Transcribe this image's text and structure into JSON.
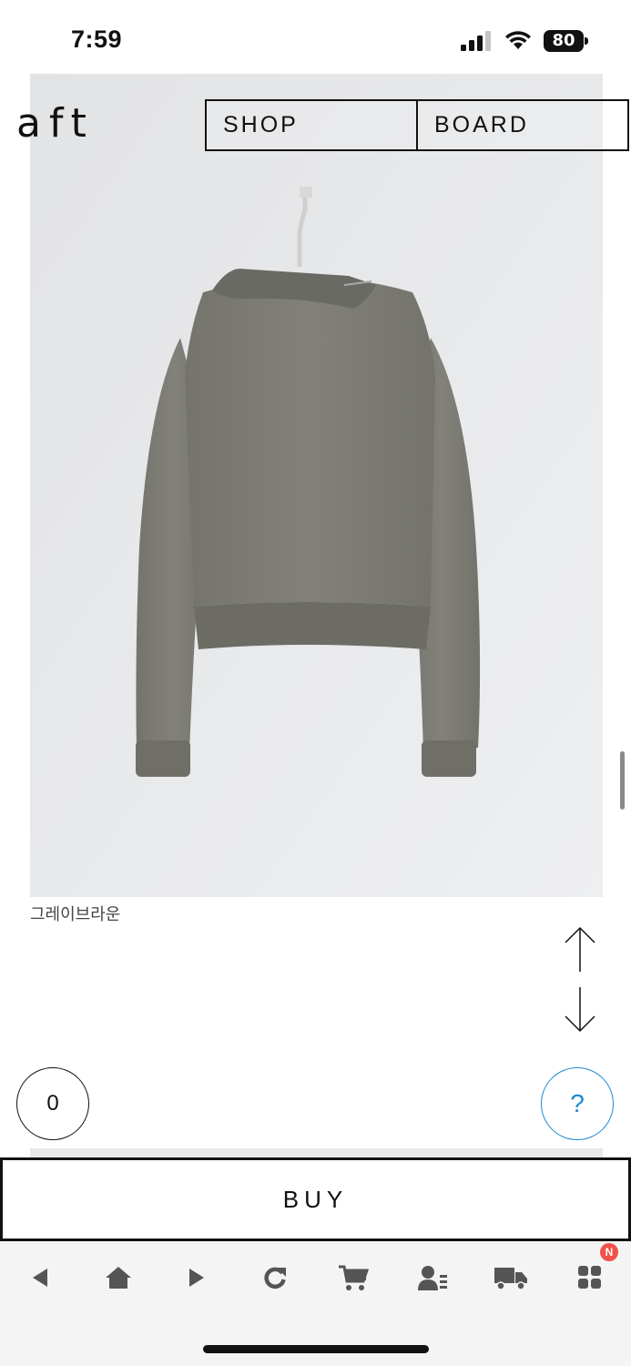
{
  "status_bar": {
    "time": "7:59",
    "battery": "80"
  },
  "header": {
    "logo": "aft",
    "nav": [
      {
        "label": "SHOP"
      },
      {
        "label": "BOARD"
      }
    ]
  },
  "product": {
    "color_caption": "그레이브라운"
  },
  "controls": {
    "scroll_up": "scroll-up-arrow",
    "scroll_down": "scroll-down-arrow",
    "cart_count": "0",
    "help_label": "?",
    "buy_label": "BUY"
  },
  "browser_toolbar": {
    "icons": [
      "back-icon",
      "home-icon",
      "forward-icon",
      "refresh-icon",
      "cart-icon",
      "my-account-icon",
      "delivery-truck-icon",
      "apps-grid-icon"
    ],
    "badge": "N"
  },
  "colors": {
    "accent_blue": "#1e88d2",
    "badge_red": "#f0524a",
    "garment": "#7c7c75"
  }
}
